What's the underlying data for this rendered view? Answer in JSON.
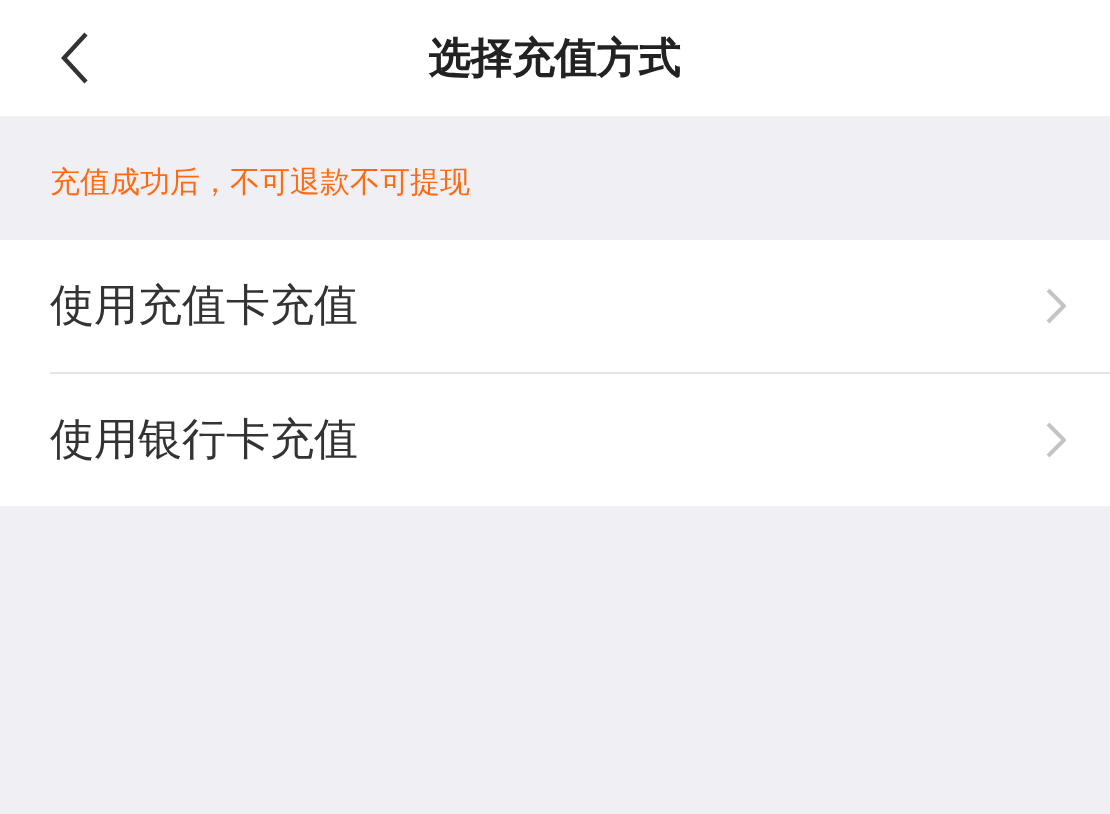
{
  "header": {
    "title": "选择充值方式"
  },
  "notice": "充值成功后，不可退款不可提现",
  "options": [
    {
      "label": "使用充值卡充值"
    },
    {
      "label": "使用银行卡充值"
    }
  ]
}
